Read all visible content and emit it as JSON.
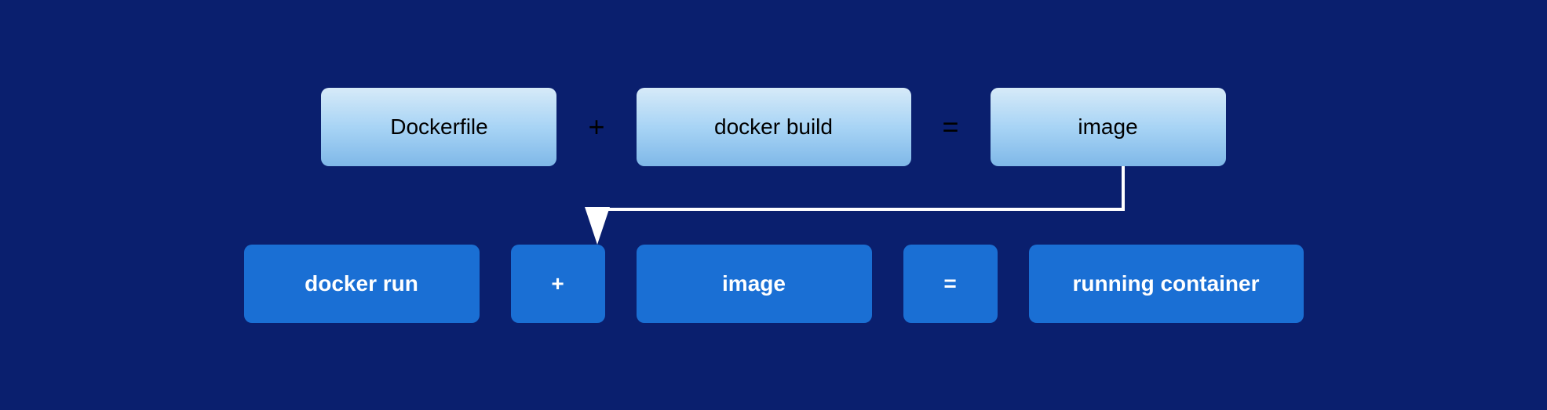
{
  "diagram": {
    "background": "#0a1f6e",
    "top_row": {
      "items": [
        {
          "id": "dockerfile",
          "text": "Dockerfile",
          "type": "large"
        },
        {
          "id": "plus1",
          "text": "+",
          "type": "operator"
        },
        {
          "id": "docker-build",
          "text": "docker build",
          "type": "xl"
        },
        {
          "id": "equals1",
          "text": "=",
          "type": "operator"
        },
        {
          "id": "image-top",
          "text": "image",
          "type": "image-box"
        }
      ]
    },
    "bottom_row": {
      "items": [
        {
          "id": "docker-run",
          "text": "docker run",
          "type": "large"
        },
        {
          "id": "plus2",
          "text": "+",
          "type": "medium"
        },
        {
          "id": "image-bottom",
          "text": "image",
          "type": "large"
        },
        {
          "id": "equals2",
          "text": "=",
          "type": "medium"
        },
        {
          "id": "running-container",
          "text": "running container",
          "type": "xl"
        }
      ]
    },
    "connector": {
      "description": "Arrow from image (top row) down to image (bottom row)"
    }
  }
}
